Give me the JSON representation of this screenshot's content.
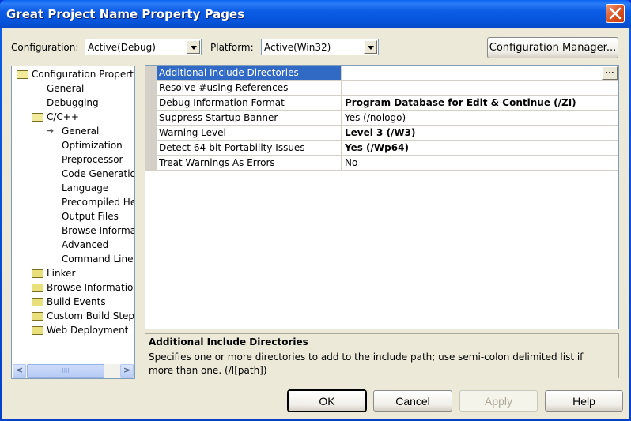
{
  "window": {
    "title": "Great Project Name Property Pages",
    "close_icon": "close-x-icon"
  },
  "toolbar": {
    "configuration_label": "Configuration:",
    "configuration_value": "Active(Debug)",
    "platform_label": "Platform:",
    "platform_value": "Active(Win32)",
    "config_manager_label": "Configuration Manager..."
  },
  "tree": {
    "items": [
      {
        "label": "Configuration Properties",
        "icon": "folder-open-icon",
        "level": 0
      },
      {
        "label": "General",
        "icon": "",
        "level": 1
      },
      {
        "label": "Debugging",
        "icon": "",
        "level": 1
      },
      {
        "label": "C/C++",
        "icon": "folder-open-icon",
        "level": 1
      },
      {
        "label": "General",
        "icon": "arrow-right-icon",
        "level": 2,
        "selected": true
      },
      {
        "label": "Optimization",
        "icon": "",
        "level": 2
      },
      {
        "label": "Preprocessor",
        "icon": "",
        "level": 2
      },
      {
        "label": "Code Generation",
        "icon": "",
        "level": 2
      },
      {
        "label": "Language",
        "icon": "",
        "level": 2
      },
      {
        "label": "Precompiled Headers",
        "icon": "",
        "level": 2
      },
      {
        "label": "Output Files",
        "icon": "",
        "level": 2
      },
      {
        "label": "Browse Information",
        "icon": "",
        "level": 2
      },
      {
        "label": "Advanced",
        "icon": "",
        "level": 2
      },
      {
        "label": "Command Line",
        "icon": "",
        "level": 2
      },
      {
        "label": "Linker",
        "icon": "folder-closed-icon",
        "level": 1
      },
      {
        "label": "Browse Information",
        "icon": "folder-closed-icon",
        "level": 1
      },
      {
        "label": "Build Events",
        "icon": "folder-closed-icon",
        "level": 1
      },
      {
        "label": "Custom Build Step",
        "icon": "folder-closed-icon",
        "level": 1
      },
      {
        "label": "Web Deployment",
        "icon": "folder-closed-icon",
        "level": 1
      }
    ],
    "scroll_left_glyph": "<",
    "scroll_right_glyph": ">",
    "scroll_thumb_grip": "IIII"
  },
  "grid": {
    "rows": [
      {
        "name": "Additional Include Directories",
        "value": "",
        "bold": false,
        "selected": true
      },
      {
        "name": "Resolve #using References",
        "value": "",
        "bold": false
      },
      {
        "name": "Debug Information Format",
        "value": "Program Database for Edit & Continue (/ZI)",
        "bold": true
      },
      {
        "name": "Suppress Startup Banner",
        "value": "Yes (/nologo)",
        "bold": false
      },
      {
        "name": "Warning Level",
        "value": "Level 3 (/W3)",
        "bold": true
      },
      {
        "name": "Detect 64-bit Portability Issues",
        "value": "Yes (/Wp64)",
        "bold": true
      },
      {
        "name": "Treat Warnings As Errors",
        "value": "No",
        "bold": false
      }
    ],
    "ellipsis_label": "..."
  },
  "description": {
    "heading": "Additional Include Directories",
    "text": "Specifies one or more directories to add to the include path; use semi-colon delimited list if more than one.     (/I[path])"
  },
  "buttons": {
    "ok": "OK",
    "cancel": "Cancel",
    "apply": "Apply",
    "help": "Help"
  }
}
